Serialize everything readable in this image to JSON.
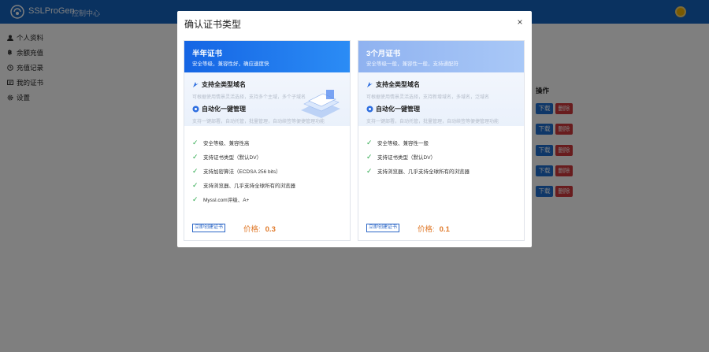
{
  "header": {
    "brand": "SSLProGen",
    "console": "控制中心"
  },
  "sidebar": {
    "items": [
      {
        "label": "个人资料",
        "icon": "user-icon"
      },
      {
        "label": "余额充值",
        "icon": "bitcoin-icon"
      },
      {
        "label": "充值记录",
        "icon": "history-icon"
      },
      {
        "label": "我的证书",
        "icon": "certificate-icon"
      },
      {
        "label": "设置",
        "icon": "gear-icon"
      }
    ]
  },
  "table": {
    "ops_header": "操作",
    "rows": [
      {
        "download": "下载",
        "delete": "删除"
      },
      {
        "download": "下载",
        "delete": "删除"
      },
      {
        "download": "下载",
        "delete": "删除"
      },
      {
        "download": "下载",
        "delete": "删除"
      },
      {
        "download": "下载",
        "delete": "删除"
      }
    ]
  },
  "modal": {
    "title": "确认证书类型",
    "close": "×",
    "cards": [
      {
        "name": "半年证书",
        "subtitle": "安全等级，兼容性好，确应速度快",
        "feature1_title": "支持全类型域名",
        "feature1_desc": "可根据使用情景灵活选择，支持多个主域，多个子域名",
        "feature2_title": "自动化一键管理",
        "feature2_desc": "支持一键部署，自动托管，批量管理，自动续签等便捷管理功能",
        "checks": [
          "安全等级、兼容性高",
          "支持证书类型（默认DV）",
          "支持加密算法（ECDSA 256 bits）",
          "支持浏览器、几乎支持全球所有的浏览器",
          "Myssl.com评级、A+"
        ],
        "button": "立即创建证书",
        "price_label": "价格:",
        "price": "0.3"
      },
      {
        "name": "3个月证书",
        "subtitle": "安全等级一般，兼容性一般，支持通配符",
        "feature1_title": "支持全类型域名",
        "feature1_desc": "可根据使用情景灵活选择，支持新增域名，多域名，泛域名",
        "feature2_title": "自动化一键管理",
        "feature2_desc": "支持一键部署，自动托管，批量管理，自动续签等便捷管理功能",
        "checks": [
          "安全等级、兼容性一般",
          "支持证书类型（默认DV）",
          "支持浏览器、几乎支持全球所有的浏览器"
        ],
        "button": "立即创建证书",
        "price_label": "价格:",
        "price": "0.1"
      }
    ]
  },
  "colors": {
    "header": "#1565c0",
    "price": "#e07a2b",
    "check": "#2aa84a",
    "download": "#1e6fd1",
    "delete": "#d0383c"
  }
}
